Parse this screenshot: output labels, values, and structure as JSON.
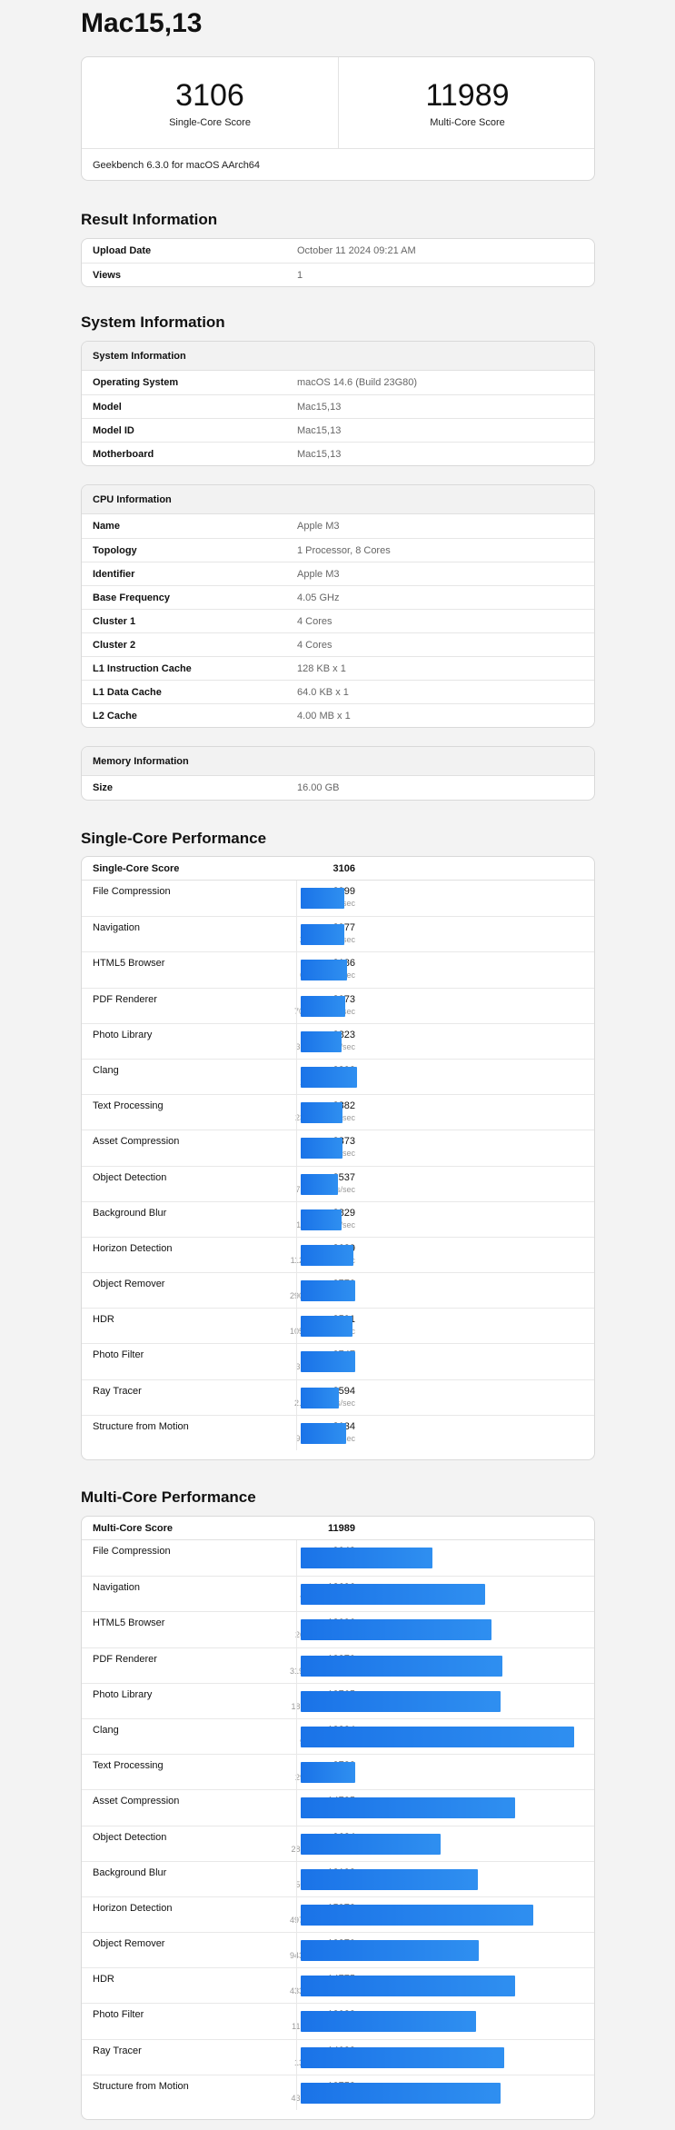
{
  "device": {
    "title": "Mac15,13"
  },
  "scores": {
    "single_value": "3106",
    "single_label": "Single-Core Score",
    "multi_value": "11989",
    "multi_label": "Multi-Core Score",
    "version": "Geekbench 6.3.0 for macOS AArch64"
  },
  "result_info": {
    "title": "Result Information",
    "rows": [
      {
        "key": "Upload Date",
        "value": "October 11 2024 09:21 AM"
      },
      {
        "key": "Views",
        "value": "1"
      }
    ]
  },
  "system_info": {
    "title": "System Information",
    "system": {
      "heading": "System Information",
      "rows": [
        {
          "key": "Operating System",
          "value": "macOS 14.6 (Build 23G80)"
        },
        {
          "key": "Model",
          "value": "Mac15,13"
        },
        {
          "key": "Model ID",
          "value": "Mac15,13"
        },
        {
          "key": "Motherboard",
          "value": "Mac15,13"
        }
      ]
    },
    "cpu": {
      "heading": "CPU Information",
      "rows": [
        {
          "key": "Name",
          "value": "Apple M3"
        },
        {
          "key": "Topology",
          "value": "1 Processor, 8 Cores"
        },
        {
          "key": "Identifier",
          "value": "Apple M3"
        },
        {
          "key": "Base Frequency",
          "value": "4.05 GHz"
        },
        {
          "key": "Cluster 1",
          "value": "4 Cores"
        },
        {
          "key": "Cluster 2",
          "value": "4 Cores"
        },
        {
          "key": "L1 Instruction Cache",
          "value": "128 KB x 1"
        },
        {
          "key": "L1 Data Cache",
          "value": "64.0 KB x 1"
        },
        {
          "key": "L2 Cache",
          "value": "4.00 MB x 1"
        }
      ]
    },
    "memory": {
      "heading": "Memory Information",
      "rows": [
        {
          "key": "Size",
          "value": "16.00 GB"
        }
      ]
    }
  },
  "single_core": {
    "title": "Single-Core Performance",
    "score_label": "Single-Core Score",
    "score_value": "3106",
    "max_score": 19500,
    "rows": [
      {
        "name": "File Compression",
        "score": 2999,
        "rate": "430.7 MB/sec"
      },
      {
        "name": "Navigation",
        "score": 2977,
        "rate": "17.9 routes/sec"
      },
      {
        "name": "HTML5 Browser",
        "score": 3186,
        "rate": "65.2 pages/sec"
      },
      {
        "name": "PDF Renderer",
        "score": 3073,
        "rate": "70.9 Mpixels/sec"
      },
      {
        "name": "Photo Library",
        "score": 2823,
        "rate": "38.3 images/sec"
      },
      {
        "name": "Clang",
        "score": 3892,
        "rate": "19.2 Klines/sec"
      },
      {
        "name": "Text Processing",
        "score": 2882,
        "rate": "230.8 pages/sec"
      },
      {
        "name": "Asset Compression",
        "score": 2873,
        "rate": "89.0 MB/sec"
      },
      {
        "name": "Object Detection",
        "score": 2537,
        "rate": "75.9 images/sec"
      },
      {
        "name": "Background Blur",
        "score": 2829,
        "rate": "11.7 images/sec"
      },
      {
        "name": "Horizon Detection",
        "score": 3629,
        "rate": "112.9 Mpixels/sec"
      },
      {
        "name": "Object Remover",
        "score": 3772,
        "rate": "290.0 Mpixels/sec"
      },
      {
        "name": "HDR",
        "score": 3591,
        "rate": "105.4 Mpixels/sec"
      },
      {
        "name": "Photo Filter",
        "score": 3747,
        "rate": "37.2 images/sec"
      },
      {
        "name": "Ray Tracer",
        "score": 2594,
        "rate": "2.51 Mpixels/sec"
      },
      {
        "name": "Structure from Motion",
        "score": 3134,
        "rate": "99.2 Kpixels/sec"
      }
    ]
  },
  "multi_core": {
    "title": "Multi-Core Performance",
    "score_label": "Multi-Core Score",
    "score_value": "11989",
    "max_score": 19500,
    "rows": [
      {
        "name": "File Compression",
        "score": 9043,
        "rate": "1.27 GB/sec"
      },
      {
        "name": "Navigation",
        "score": 12696,
        "rate": "76.5 routes/sec"
      },
      {
        "name": "HTML5 Browser",
        "score": 13096,
        "rate": "268.1 pages/sec"
      },
      {
        "name": "PDF Renderer",
        "score": 13870,
        "rate": "319.9 Mpixels/sec"
      },
      {
        "name": "Photo Library",
        "score": 13765,
        "rate": "186.8 images/sec"
      },
      {
        "name": "Clang",
        "score": 18824,
        "rate": "92.7 Klines/sec"
      },
      {
        "name": "Text Processing",
        "score": 3738,
        "rate": "299.3 pages/sec"
      },
      {
        "name": "Asset Compression",
        "score": 14735,
        "rate": "456.6 MB/sec"
      },
      {
        "name": "Object Detection",
        "score": 9624,
        "rate": "288.0 images/sec"
      },
      {
        "name": "Background Blur",
        "score": 12198,
        "rate": "50.5 images/sec"
      },
      {
        "name": "Horizon Detection",
        "score": 15972,
        "rate": "497.0 Mpixels/sec"
      },
      {
        "name": "Object Remover",
        "score": 12270,
        "rate": "943.4 Mpixels/sec"
      },
      {
        "name": "HDR",
        "score": 14775,
        "rate": "433.6 Mpixels/sec"
      },
      {
        "name": "Photo Filter",
        "score": 12083,
        "rate": "119.9 images/sec"
      },
      {
        "name": "Ray Tracer",
        "score": 14023,
        "rate": "13.6 Mpixels/sec"
      },
      {
        "name": "Structure from Motion",
        "score": 13753,
        "rate": "435.4 Kpixels/sec"
      }
    ]
  }
}
